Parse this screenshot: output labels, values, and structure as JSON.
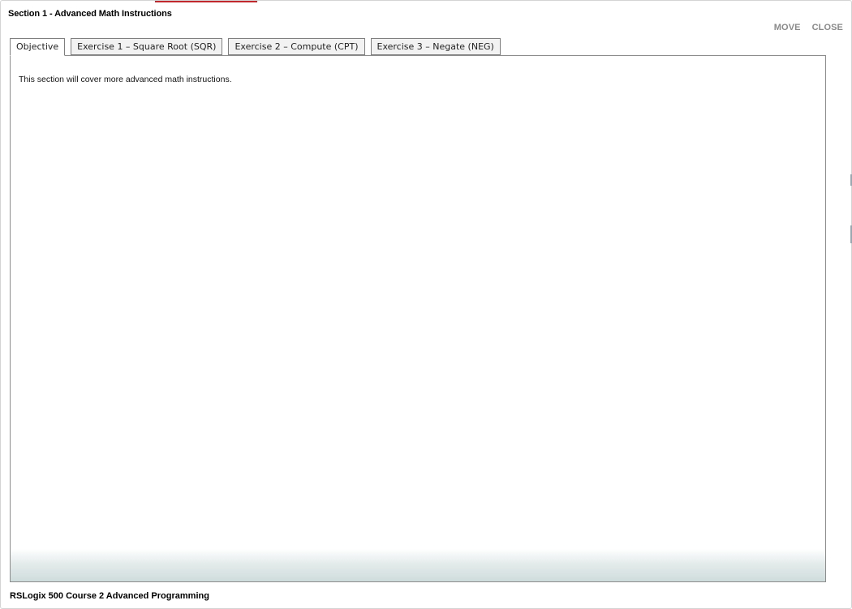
{
  "window": {
    "title": "Section 1 - Advanced Math Instructions",
    "controls": {
      "move_label": "MOVE",
      "close_label": "CLOSE"
    },
    "accent_color": "#c0282d"
  },
  "tabs": [
    {
      "label": "Objective",
      "active": true
    },
    {
      "label": "Exercise 1 – Square Root (SQR)",
      "active": false
    },
    {
      "label": "Exercise 2 – Compute (CPT)",
      "active": false
    },
    {
      "label": "Exercise 3 – Negate (NEG)",
      "active": false
    }
  ],
  "content": {
    "text": "This section will cover more advanced math instructions."
  },
  "footer": {
    "course_title": "RSLogix 500 Course 2 Advanced Programming"
  }
}
